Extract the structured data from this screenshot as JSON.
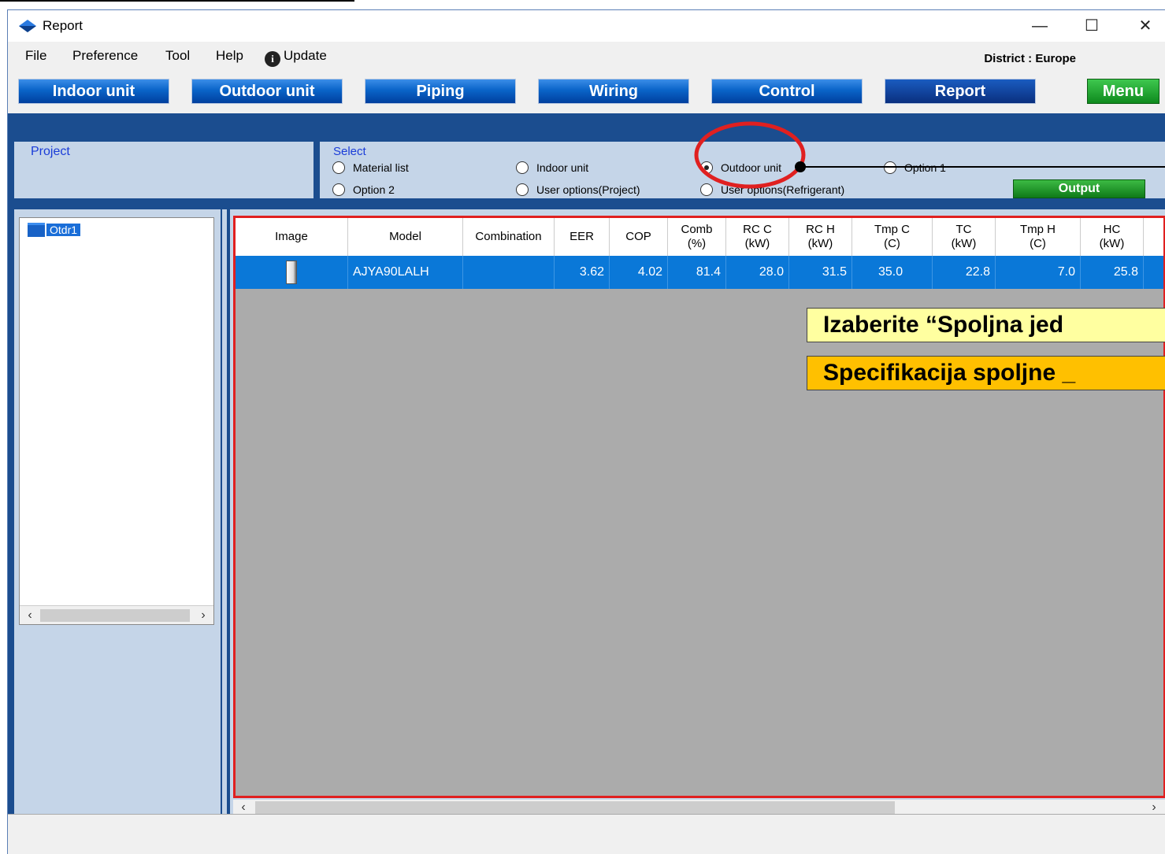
{
  "window": {
    "title": "Report"
  },
  "window_controls": {
    "minimize": "—",
    "maximize": "☐",
    "close": "✕"
  },
  "menu": {
    "file": "File",
    "preference": "Preference",
    "tool": "Tool",
    "help": "Help",
    "update": "Update"
  },
  "district": "District : Europe",
  "nav": {
    "indoor": "Indoor unit",
    "outdoor": "Outdoor unit",
    "piping": "Piping",
    "wiring": "Wiring",
    "control": "Control",
    "report": "Report",
    "menu": "Menu"
  },
  "project": {
    "label": "Project"
  },
  "select": {
    "label": "Select",
    "options": [
      "Material list",
      "Indoor unit",
      "Outdoor unit",
      "Option 1",
      "Option 2",
      "User options(Project)",
      "User options(Refrigerant)"
    ],
    "selected": "Outdoor unit",
    "output_label": "Output"
  },
  "tree": {
    "item": "Otdr1"
  },
  "table": {
    "columns": [
      "Image",
      "Model",
      "Combination",
      "EER",
      "COP",
      "Comb\n(%)",
      "RC C\n(kW)",
      "RC H\n(kW)",
      "Tmp C\n(C)",
      "TC\n(kW)",
      "Tmp H\n(C)",
      "HC\n(kW)"
    ],
    "row": {
      "model": "AJYA90LALH",
      "combination": "",
      "eer": "3.62",
      "cop": "4.02",
      "comb": "81.4",
      "rcc": "28.0",
      "rch": "31.5",
      "tmpc": "35.0",
      "tc": "22.8",
      "tmph": "7.0",
      "hc": "25.8"
    }
  },
  "callouts": {
    "first": "Izaberite “Spoljna jed",
    "second": "Specifikacija spoljne _"
  },
  "colors": {
    "accent_blue": "#1b4d8f",
    "highlight_red": "#e02020",
    "callout_yellow": "#ffffa0",
    "callout_orange": "#ffc000"
  }
}
